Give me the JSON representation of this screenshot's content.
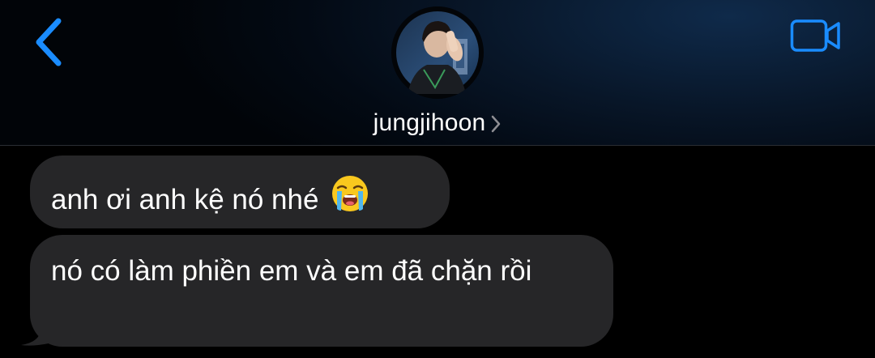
{
  "header": {
    "contact_name": "jungjihoon",
    "back_icon": "chevron-left-icon",
    "video_icon": "video-camera-icon",
    "accent_color": "#1a8cff"
  },
  "messages": [
    {
      "text": "anh ơi anh kệ nó nhé",
      "emoji": "loudly-crying-face",
      "direction": "incoming"
    },
    {
      "text": "nó có làm phiền em và em đã chặn rồi",
      "direction": "incoming"
    }
  ],
  "colors": {
    "background": "#000000",
    "incoming_bubble": "#262628",
    "text": "#ffffff"
  }
}
